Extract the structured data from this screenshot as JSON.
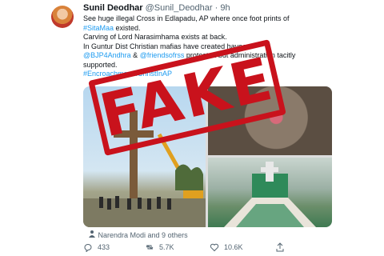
{
  "tweet": {
    "author_name": "Sunil Deodhar",
    "handle": "@Sunil_Deodhar",
    "separator": "·",
    "time": "9h",
    "lines": [
      {
        "parts": [
          {
            "text": "See huge illegal Cross in Edlapadu, AP where once foot prints of",
            "link": false
          }
        ]
      },
      {
        "parts": [
          {
            "text": "#SitaMaa",
            "link": true
          },
          {
            "text": " existed.",
            "link": false
          }
        ]
      },
      {
        "parts": [
          {
            "text": "Carving of Lord Narasimhama exists at back.",
            "link": false
          }
        ]
      },
      {
        "parts": [
          {
            "text": "In Guntur Dist Christian mafias have created havoc.",
            "link": false
          }
        ]
      },
      {
        "parts": [
          {
            "text": "@BJP4Andhra",
            "link": true
          },
          {
            "text": " & ",
            "link": false
          },
          {
            "text": "@friendsofrss",
            "link": true
          },
          {
            "text": " protested but administration tacitly",
            "link": false
          }
        ]
      },
      {
        "parts": [
          {
            "text": "supported.",
            "link": false
          }
        ]
      },
      {
        "parts": [
          {
            "text": "#Encroachment4ChristInAP",
            "link": true
          }
        ]
      }
    ],
    "media_tag": "Narendra Modi and 9 others",
    "replies": "433",
    "retweets": "5.7K",
    "likes": "10.6K"
  },
  "stamp": {
    "text": "FAKE",
    "color": "#c9121c"
  },
  "colors": {
    "link": "#1d9bf0",
    "secondary": "#536471"
  },
  "icons": [
    "reply-icon",
    "retweet-icon",
    "like-icon",
    "share-icon",
    "person-tag-icon"
  ]
}
